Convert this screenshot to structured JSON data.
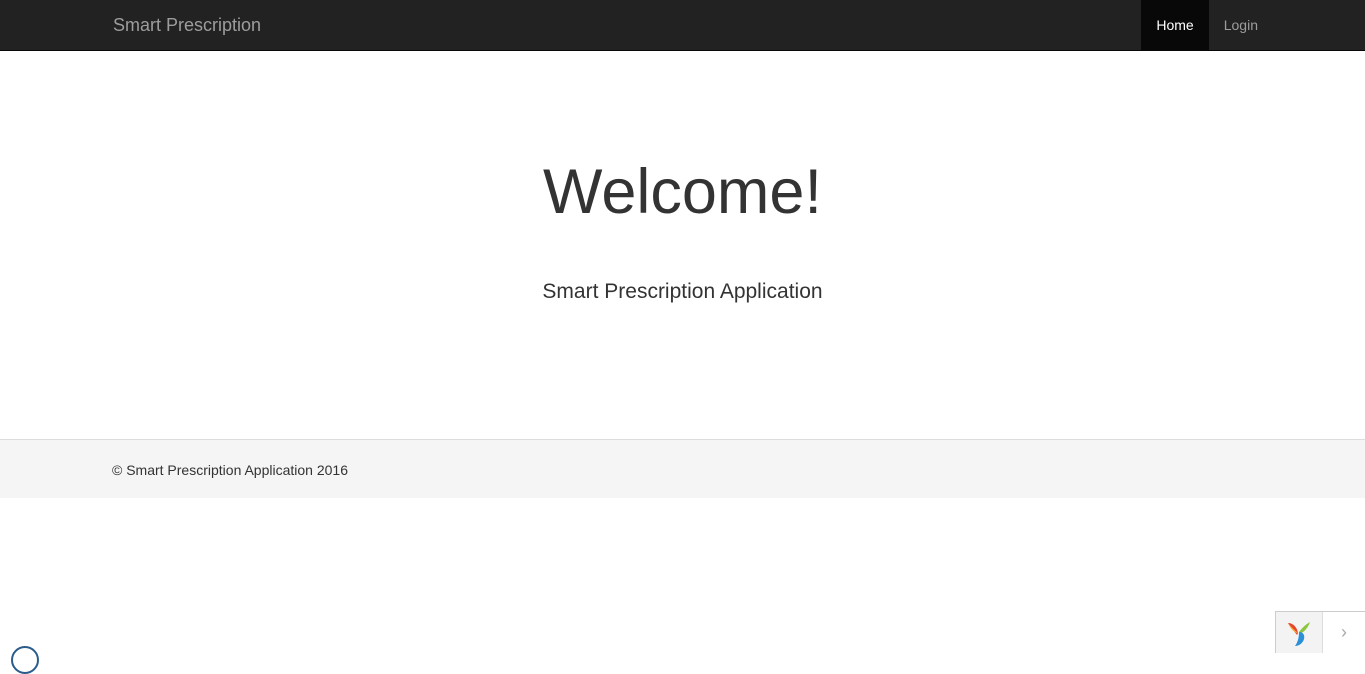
{
  "navbar": {
    "brand": "Smart Prescription",
    "items": [
      {
        "label": "Home",
        "active": true
      },
      {
        "label": "Login",
        "active": false
      }
    ]
  },
  "hero": {
    "title": "Welcome!",
    "subtitle": "Smart Prescription Application"
  },
  "footer": {
    "text": "© Smart Prescription Application 2016"
  },
  "debug_toolbar": {
    "logo_icon": "yii-logo-icon",
    "toggle_icon": "chevron-right-icon"
  },
  "colors": {
    "navbar_bg": "#222222",
    "nav_active_bg": "#080808",
    "nav_text": "#9d9d9d",
    "footer_bg": "#f5f5f5",
    "text": "#333333"
  }
}
